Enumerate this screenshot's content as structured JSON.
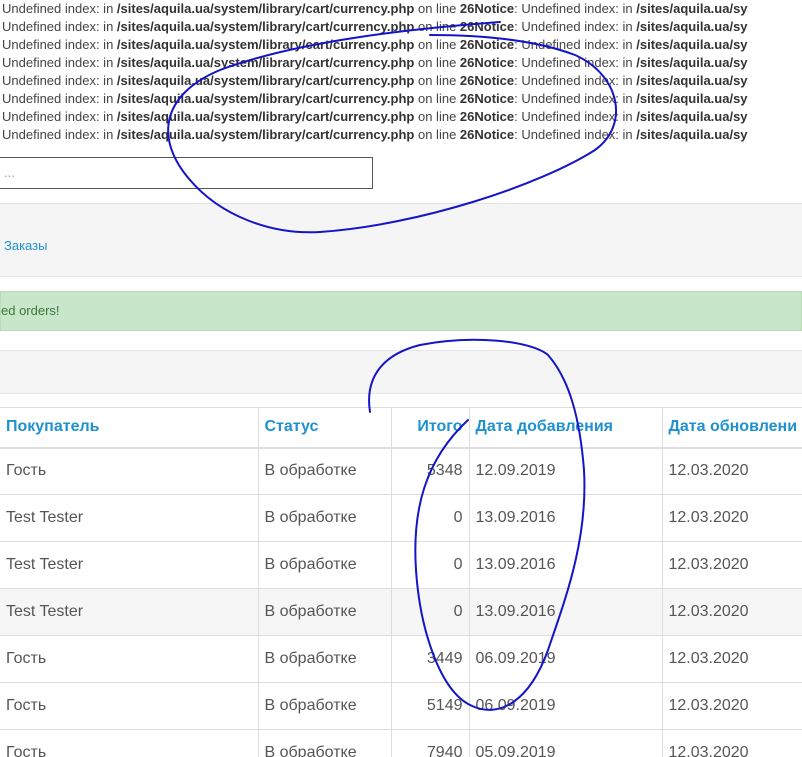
{
  "notice": {
    "prefix": "Undefined index: in ",
    "path": "/sites/aquila.ua/system/library/cart/currency.php",
    "middle": " on line ",
    "line_and_notice": "26Notice",
    "suffix": ": Undefined index: in ",
    "path_tail": "/sites/aquila.ua/sy"
  },
  "filter": {
    "placeholder": "..."
  },
  "breadcrumb": {
    "orders": "Заказы"
  },
  "alert": {
    "text": "ed orders!"
  },
  "table": {
    "headers": {
      "customer": "Покупатель",
      "status": "Статус",
      "total": "Итого",
      "date_added": "Дата добавления",
      "date_modified": "Дата обновлени"
    },
    "rows": [
      {
        "customer": "Гость",
        "status": "В обработке",
        "total": "5348",
        "date_added": "12.09.2019",
        "date_modified": "12.03.2020"
      },
      {
        "customer": "Test Tester",
        "status": "В обработке",
        "total": "0",
        "date_added": "13.09.2016",
        "date_modified": "12.03.2020"
      },
      {
        "customer": "Test Tester",
        "status": "В обработке",
        "total": "0",
        "date_added": "13.09.2016",
        "date_modified": "12.03.2020"
      },
      {
        "customer": "Test Tester",
        "status": "В обработке",
        "total": "0",
        "date_added": "13.09.2016",
        "date_modified": "12.03.2020"
      },
      {
        "customer": "Гость",
        "status": "В обработке",
        "total": "3449",
        "date_added": "06.09.2019",
        "date_modified": "12.03.2020"
      },
      {
        "customer": "Гость",
        "status": "В обработке",
        "total": "5149",
        "date_added": "06.09.2019",
        "date_modified": "12.03.2020"
      },
      {
        "customer": "Гость",
        "status": "В обработке",
        "total": "7940",
        "date_added": "05.09.2019",
        "date_modified": "12.03.2020"
      }
    ]
  },
  "colors": {
    "link": "#1e91cf",
    "alert_bg": "#c8e6c9",
    "pen": "#1414c8"
  }
}
